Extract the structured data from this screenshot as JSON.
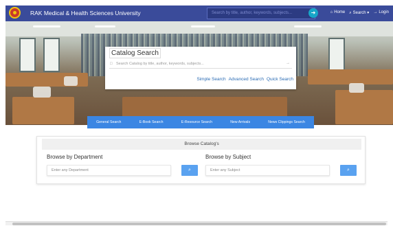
{
  "navbar": {
    "brand": "RAK Medical & Health Sciences University",
    "search_placeholder": "Search by title, author, keywords, subjects...",
    "links": [
      {
        "icon": "home-icon",
        "glyph": "⌂",
        "label": "Home"
      },
      {
        "icon": "search-icon",
        "glyph": "⌕",
        "label": "Search ▾"
      },
      {
        "icon": "login-icon",
        "glyph": "→",
        "label": "Login"
      }
    ]
  },
  "catalog": {
    "title": "Catalog Search",
    "placeholder": "Search Catalog by title, author, keywords, subjects...",
    "links": [
      "Simple Search",
      "Advanced Search",
      "Quick Search"
    ]
  },
  "tabs": [
    "General Search",
    "E-Book Search",
    "E-Resource Search",
    "New Arrivals",
    "News Clippings Search"
  ],
  "browse": {
    "heading": "Browse Catalog's",
    "department": {
      "title": "Browse by Department",
      "placeholder": "Enter any Department"
    },
    "subject": {
      "title": "Browse by Subject",
      "placeholder": "Enter any Subject"
    },
    "button_glyph": "⌕"
  },
  "colors": {
    "navbar": "#3a4b9a",
    "tabs": "#3b86e3",
    "link": "#2a6bb4",
    "button": "#5aa2f0"
  }
}
